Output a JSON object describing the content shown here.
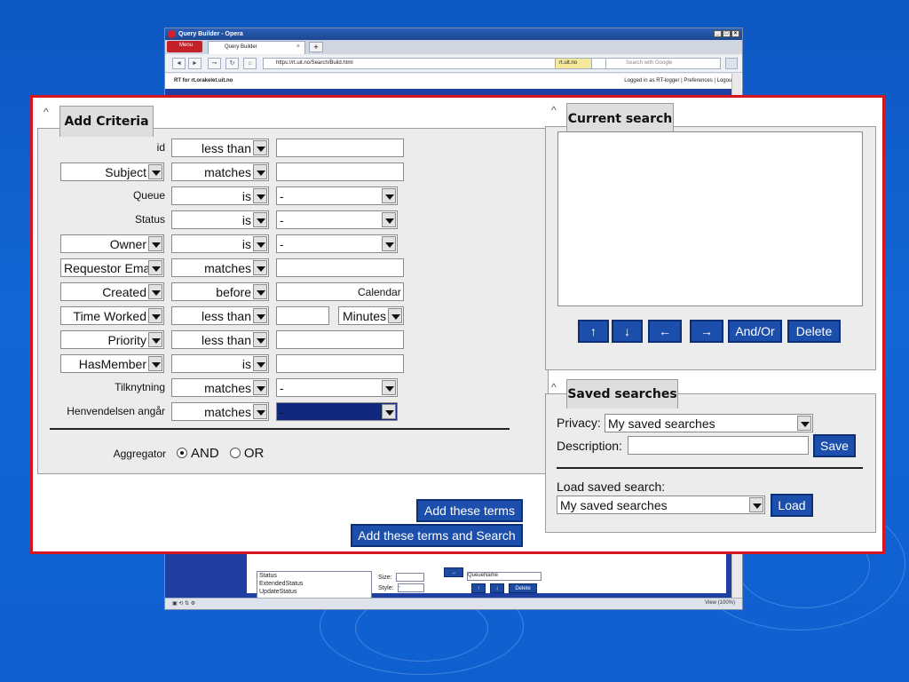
{
  "browser": {
    "window_title": "Query Builder - Opera",
    "menu_label": "Menu",
    "tab_title": "Query Builder",
    "tab_close": "×",
    "new_tab": "+",
    "address": "https://rt.uit.no/Search/Build.html",
    "site_badge": "rt.uit.no",
    "search_placeholder": "Search with Google",
    "status_right": "View (100%)"
  },
  "rt": {
    "site_title": "RT for rt.orakelet.uit.no",
    "user_links": "Logged in as RT-logger | Preferences | Logout"
  },
  "lower_bg": {
    "fields": [
      "Status",
      "ExtendedStatus",
      "UpdateStatus"
    ],
    "size_label": "Size:",
    "style_label": "Style:",
    "style_value": "-",
    "sort_value": "QueueName",
    "arrow_right": "→",
    "up": "↑",
    "down": "↓",
    "delete": "Delete"
  },
  "add_criteria": {
    "title": "Add Criteria",
    "rows": [
      {
        "field": "id",
        "field_select": false,
        "op": "less than",
        "value": "",
        "value_type": "text"
      },
      {
        "field": "Subject",
        "field_select": true,
        "op": "matches",
        "value": "",
        "value_type": "text"
      },
      {
        "field": "Queue",
        "field_select": false,
        "op": "is",
        "value": "-",
        "value_type": "select"
      },
      {
        "field": "Status",
        "field_select": false,
        "op": "is",
        "value": "-",
        "value_type": "select"
      },
      {
        "field": "Owner",
        "field_select": true,
        "op": "is",
        "value": "-",
        "value_type": "select"
      },
      {
        "field": "Requestor Ema",
        "field_select": true,
        "op": "matches",
        "value": "",
        "value_type": "text"
      },
      {
        "field": "Created",
        "field_select": true,
        "op": "before",
        "value": "",
        "value_type": "date"
      },
      {
        "field": "Time Worked",
        "field_select": true,
        "op": "less than",
        "value": "",
        "value_type": "unit"
      },
      {
        "field": "Priority",
        "field_select": true,
        "op": "less than",
        "value": "",
        "value_type": "text"
      },
      {
        "field": "HasMember",
        "field_select": true,
        "op": "is",
        "value": "",
        "value_type": "text"
      },
      {
        "field": "Tilknytning",
        "field_select": false,
        "op": "matches",
        "value": "-",
        "value_type": "select"
      },
      {
        "field": "Henvendelsen angår",
        "field_select": false,
        "op": "matches",
        "value": "-",
        "value_type": "select_highlight"
      }
    ],
    "calendar_label": "Calendar",
    "unit_value": "Minutes",
    "aggregator_label": "Aggregator",
    "and_label": "AND",
    "or_label": "OR",
    "aggregator_selected": "AND"
  },
  "actions": {
    "add_terms": "Add these terms",
    "add_and_search": "Add these terms and Search"
  },
  "current_search": {
    "title": "Current search",
    "buttons": [
      "↑",
      "↓",
      "←",
      "→",
      "And/Or",
      "Delete"
    ]
  },
  "saved_searches": {
    "title": "Saved searches",
    "privacy_label": "Privacy:",
    "privacy_value": "My saved searches",
    "description_label": "Description:",
    "save_button": "Save",
    "load_label": "Load saved search:",
    "load_value": "My saved searches",
    "load_button": "Load"
  },
  "colors": {
    "background": "#1366d6",
    "highlight_border": "#d8141e",
    "button_blue": "#1c4fab",
    "panel_gray": "#ececec"
  }
}
